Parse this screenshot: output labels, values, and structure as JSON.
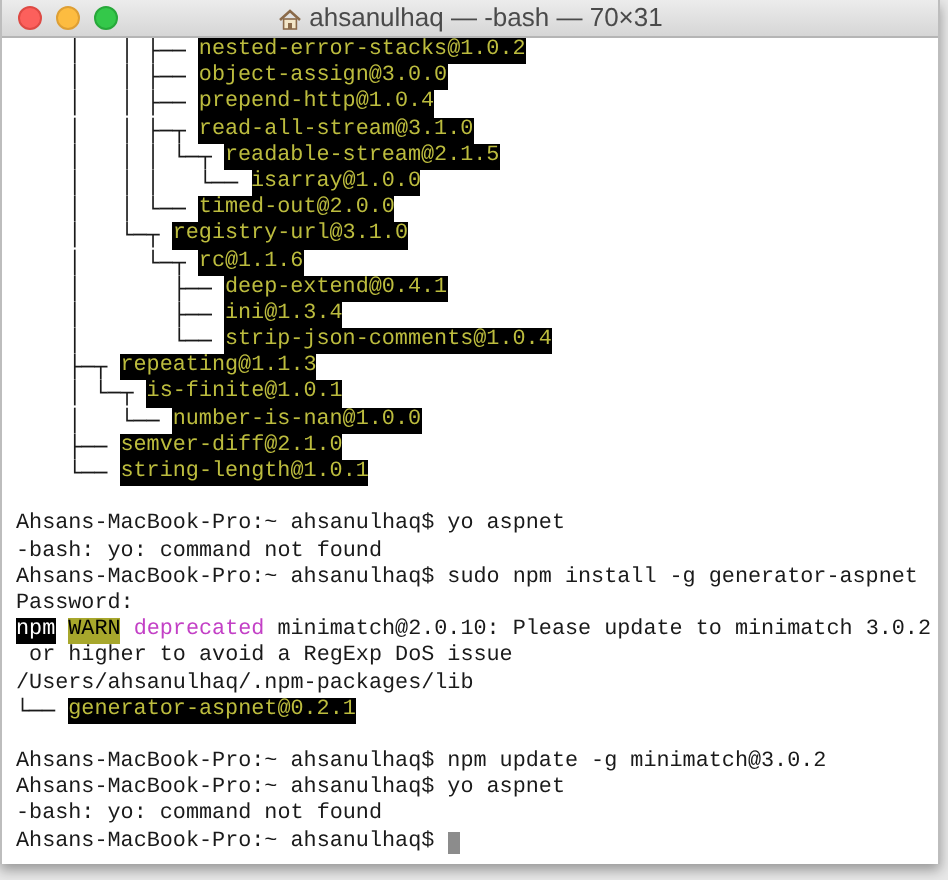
{
  "window": {
    "title": "ahsanulhaq — -bash — 70×31"
  },
  "terminal": {
    "lines": [
      {
        "kind": "tree",
        "prefix": "    │   │ ├── ",
        "package": "nested-error-stacks@1.0.2"
      },
      {
        "kind": "tree",
        "prefix": "    │   │ ├── ",
        "package": "object-assign@3.0.0"
      },
      {
        "kind": "tree",
        "prefix": "    │   │ ├── ",
        "package": "prepend-http@1.0.4"
      },
      {
        "kind": "tree",
        "prefix": "    │   │ ├─┬ ",
        "package": "read-all-stream@3.1.0"
      },
      {
        "kind": "tree",
        "prefix": "    │   │ │ └─┬ ",
        "package": "readable-stream@2.1.5"
      },
      {
        "kind": "tree",
        "prefix": "    │   │ │   └── ",
        "package": "isarray@1.0.0"
      },
      {
        "kind": "tree",
        "prefix": "    │   │ └── ",
        "package": "timed-out@2.0.0"
      },
      {
        "kind": "tree",
        "prefix": "    │   └─┬ ",
        "package": "registry-url@3.1.0"
      },
      {
        "kind": "tree",
        "prefix": "    │     └─┬ ",
        "package": "rc@1.1.6"
      },
      {
        "kind": "tree",
        "prefix": "    │       ├── ",
        "package": "deep-extend@0.4.1"
      },
      {
        "kind": "tree",
        "prefix": "    │       ├── ",
        "package": "ini@1.3.4"
      },
      {
        "kind": "tree",
        "prefix": "    │       └── ",
        "package": "strip-json-comments@1.0.4"
      },
      {
        "kind": "tree",
        "prefix": "    ├─┬ ",
        "package": "repeating@1.1.3"
      },
      {
        "kind": "tree",
        "prefix": "    │ └─┬ ",
        "package": "is-finite@1.0.1"
      },
      {
        "kind": "tree",
        "prefix": "    │   └── ",
        "package": "number-is-nan@1.0.0"
      },
      {
        "kind": "tree",
        "prefix": "    ├── ",
        "package": "semver-diff@2.1.0"
      },
      {
        "kind": "tree",
        "prefix": "    └── ",
        "package": "string-length@1.0.1"
      },
      {
        "kind": "blank"
      },
      {
        "kind": "text",
        "text": "Ahsans-MacBook-Pro:~ ahsanulhaq$ yo aspnet"
      },
      {
        "kind": "text",
        "text": "-bash: yo: command not found"
      },
      {
        "kind": "text",
        "text": "Ahsans-MacBook-Pro:~ ahsanulhaq$ sudo npm install -g generator-aspnet"
      },
      {
        "kind": "text",
        "text": "Password:"
      },
      {
        "kind": "warning",
        "program": "npm",
        "level": "WARN",
        "tag": "deprecated",
        "message": "minimatch@2.0.10: Please update to minimatch 3.0.2"
      },
      {
        "kind": "text",
        "text": " or higher to avoid a RegExp DoS issue"
      },
      {
        "kind": "text",
        "text": "/Users/ahsanulhaq/.npm-packages/lib"
      },
      {
        "kind": "tree",
        "prefix": "└── ",
        "package": "generator-aspnet@0.2.1"
      },
      {
        "kind": "blank"
      },
      {
        "kind": "text",
        "text": "Ahsans-MacBook-Pro:~ ahsanulhaq$ npm update -g minimatch@3.0.2"
      },
      {
        "kind": "text",
        "text": "Ahsans-MacBook-Pro:~ ahsanulhaq$ yo aspnet"
      },
      {
        "kind": "text",
        "text": "-bash: yo: command not found"
      },
      {
        "kind": "text",
        "cursor": true,
        "text": "Ahsans-MacBook-Pro:~ ahsanulhaq$"
      }
    ]
  }
}
